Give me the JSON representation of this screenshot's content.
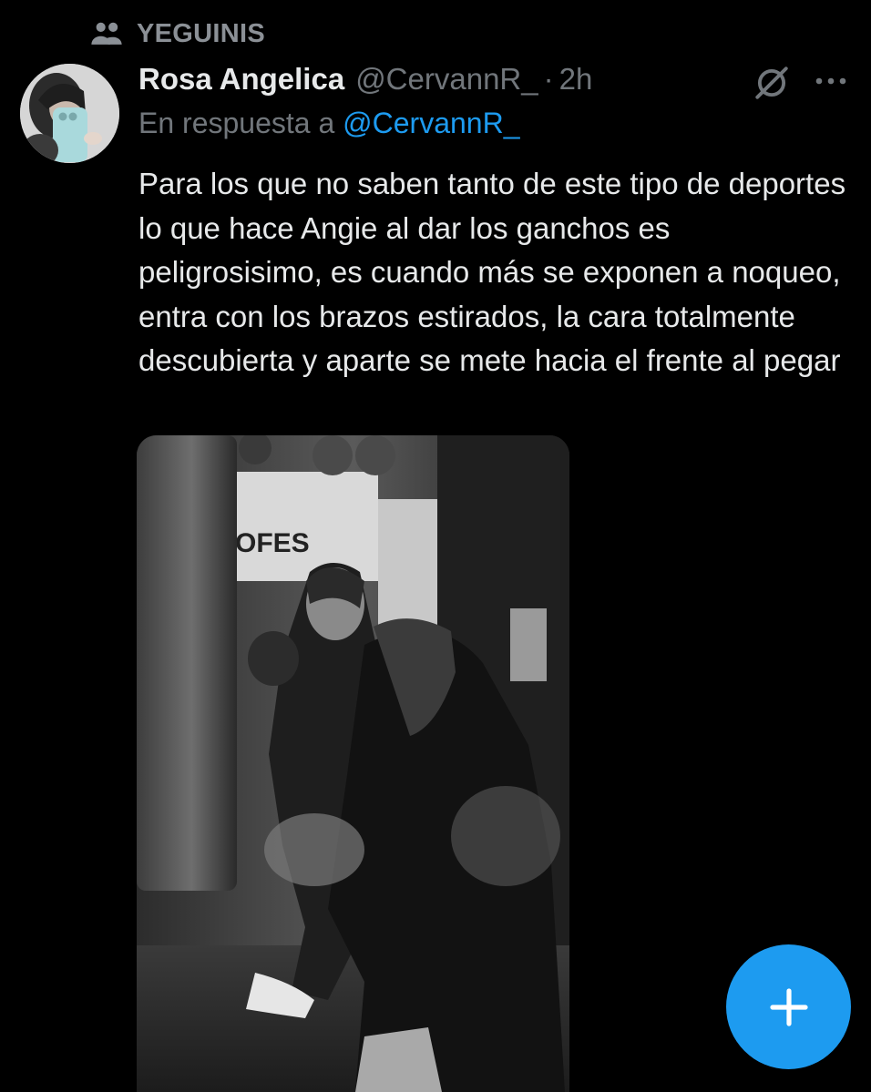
{
  "community": {
    "icon": "community-people-icon",
    "name": "YEGUINIS"
  },
  "tweet": {
    "author": {
      "display_name": "Rosa Angelica",
      "handle": "@CervannR_",
      "avatar": "profile-avatar"
    },
    "separator": "·",
    "time": "2h",
    "reply": {
      "prefix": "En respuesta a",
      "target": "@CervannR_"
    },
    "text": "Para los que no saben tanto de este tipo de deportes lo que hace Angie al dar los ganchos es peligrosisimo, es cuando más se exponen a noqueo, entra con los brazos estirados, la cara totalmente descubierta y aparte se mete hacia el frente al pegar",
    "media": {
      "sign_text": "OFES"
    }
  },
  "actions": {
    "grok_icon": "grok-icon",
    "more_icon": "more-icon"
  },
  "compose_button": {
    "icon": "plus-icon"
  },
  "colors": {
    "background": "#000000",
    "accent": "#1d9bf0",
    "muted": "#71767b",
    "text": "#e7e9ea"
  }
}
